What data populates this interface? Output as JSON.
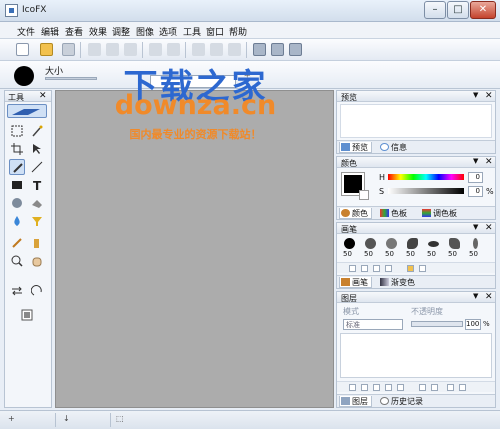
{
  "window": {
    "title": "IcoFX"
  },
  "menu": [
    "文件",
    "编辑",
    "查看",
    "效果",
    "调整",
    "图像",
    "选项",
    "工具",
    "窗口",
    "帮助"
  ],
  "brush_bar": {
    "size_label": "大小"
  },
  "tools_panel": {
    "title": "工具"
  },
  "watermark": {
    "title": "下载之家",
    "url": "downza.cn",
    "tagline": "国内最专业的资源下载站！"
  },
  "preview_panel": {
    "title": "预览",
    "tabs": [
      "预览",
      "信息"
    ]
  },
  "color_panel": {
    "title": "颜色",
    "h_label": "H",
    "s_label": "S",
    "h_value": "0",
    "s_value": "0",
    "s_unit": "%",
    "tabs": [
      "颜色",
      "色板",
      "调色板"
    ]
  },
  "brush_panel": {
    "title": "画笔",
    "sizes": [
      "50",
      "50",
      "50",
      "50",
      "50",
      "50",
      "50"
    ],
    "tabs": [
      "画笔",
      "渐变色"
    ]
  },
  "layers_panel": {
    "title": "图层",
    "mode_label": "模式",
    "opacity_label": "不透明度",
    "blend_mode": "标准",
    "opacity_value": "100",
    "opacity_unit": "%",
    "tabs": [
      "图层",
      "历史记录"
    ]
  },
  "status_bar": {
    "cells": [
      "+",
      "↓",
      "⬚"
    ]
  },
  "colors": {
    "accent": "#2d68d0",
    "watermark_orange": "#f08a2a",
    "canvas_bg": "#acacac"
  }
}
